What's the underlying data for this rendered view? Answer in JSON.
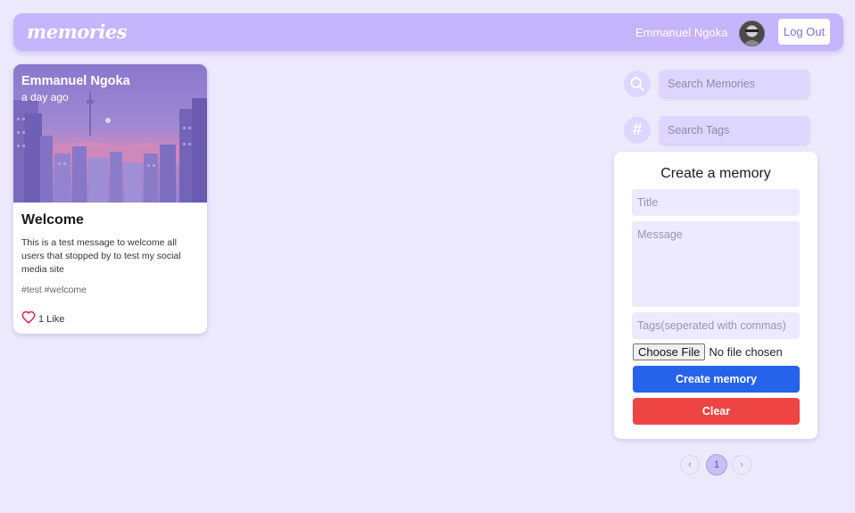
{
  "navbar": {
    "logo": "memories",
    "user_name": "Emmanuel Ngoka",
    "logout_label": "Log Out"
  },
  "post": {
    "author": "Emmanuel Ngoka",
    "time": "a day ago",
    "title": "Welcome",
    "message": "This is a test message to welcome all users that stopped by to test my social media site",
    "tags": "#test #welcome",
    "like_count": "1 Like"
  },
  "search": {
    "memories_placeholder": "Search Memories",
    "tags_placeholder": "Search Tags",
    "tags_icon_glyph": "#"
  },
  "form": {
    "heading": "Create a memory",
    "title_placeholder": "Title",
    "message_placeholder": "Message",
    "tags_placeholder": "Tags(seperated with commas)",
    "file_button": "Choose File",
    "file_status": "No file chosen",
    "submit_label": "Create memory",
    "clear_label": "Clear"
  },
  "pagination": {
    "prev": "‹",
    "current": "1",
    "next": "›"
  },
  "colors": {
    "background": "#ede9fd",
    "navbar": "#c4b5fc",
    "primary": "#2563eb",
    "danger": "#ef4444",
    "heart": "#e11d48"
  }
}
